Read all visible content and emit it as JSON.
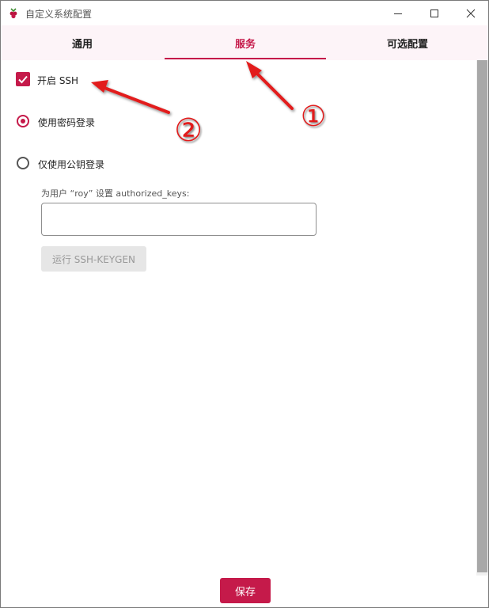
{
  "window": {
    "title": "自定义系统配置",
    "app_icon": "raspberry-icon",
    "controls": [
      "minimize-icon",
      "maximize-icon",
      "close-icon"
    ]
  },
  "tabs": [
    {
      "label": "通用",
      "active": false
    },
    {
      "label": "服务",
      "active": true
    },
    {
      "label": "可选配置",
      "active": false
    }
  ],
  "ssh": {
    "enable_label": "开启 SSH",
    "enabled": true,
    "auth_options": [
      {
        "label": "使用密码登录",
        "selected": true
      },
      {
        "label": "仅使用公钥登录",
        "selected": false
      }
    ],
    "keys_label": "为用户 “roy” 设置 authorized_keys:",
    "keys_value": "",
    "keygen_button": "运行 SSH-KEYGEN"
  },
  "footer": {
    "save_button": "保存"
  },
  "annotations": [
    {
      "marker": "①",
      "color": "#e21b1b"
    },
    {
      "marker": "②",
      "color": "#e21b1b"
    }
  ],
  "colors": {
    "accent": "#c51a4a",
    "tab_bar": "#fdf4f8",
    "annotation": "#e21b1b"
  }
}
